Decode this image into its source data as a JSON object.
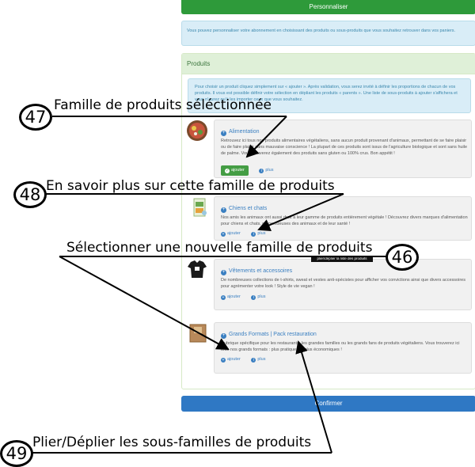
{
  "buttons": {
    "personnaliser": "Personnaliser",
    "confirmer": "Confirmer"
  },
  "info_top": "Vous pouvez personnaliser votre abonnement en choisissant des produits ou sous-produits que vous souhaitez retrouver dans vos paniers.",
  "panel": {
    "title": "Produits",
    "info": "Pour choisir un produit cliquez simplement sur « ajouter ». Après validation, vous serez invité à définir les proportions de chacun de vos produits. Il vous est possible définir votre sélection en dépliant les produits « parents ». Une liste de sous-produits à ajouter s'affichera et vous n'aurez qu'à les importer ceux que vous souhaitez."
  },
  "items": [
    {
      "title": "Alimentation",
      "desc": "Retrouvez ici tous nos produits alimentaires végétaliens, sans aucun produit provenant d'animaux, permettant de se faire plaisir ou de faire plaisir sans mauvaise conscience ! La plupart de ces produits sont issus de l'agriculture biologique et sont sans huile de palme. Vous trouverez également des produits sans gluten ou 100% crus. Bon appétit !",
      "add": "ajouter",
      "more": "plus",
      "selected": true
    },
    {
      "title": "Chiens et chats",
      "desc": "Nos amis les animaux ont aussi droit à leur gamme de produits entièrement végétale ! Découvrez divers marques d'alimentation pour chiens et chats, respectueuses des animaux et de leur santé !",
      "add": "ajouter",
      "more": "plus",
      "selected": false
    },
    {
      "title": "Vêtements et accessoires",
      "desc": "De nombreuses collections de t-shirts, sweat et vestes anti-spécistes pour afficher vos convictions ainsi que divers accessoires pour agrémenter votre look ! Style de vie vegan !",
      "add": "ajouter",
      "more": "plus",
      "selected": false
    },
    {
      "title": "Grands Formats | Pack restauration",
      "desc": "Rubrique spécifique pour les restaurants, les grandes familles ou les grands fans de produits végétaliens. Vous trouverez ici tous nos grands formats : plus pratiques et plus économiques !",
      "add": "ajouter",
      "more": "plus",
      "selected": false
    }
  ],
  "tooltip": "plier/déplier la liste des produits",
  "callouts": {
    "c47": {
      "num": "47",
      "text": "Famille de produits séléctionnée"
    },
    "c48": {
      "num": "48",
      "text": "En savoir plus sur cette famille de produits"
    },
    "c46": {
      "num": "46",
      "text": "Sélectionner une nouvelle famille de produits"
    },
    "c49": {
      "num": "49",
      "text": "Plier/Déplier les sous-familles de produits"
    }
  },
  "colors": {
    "green": "#2e9a3a",
    "blue": "#2f78c4",
    "link": "#3a7fc1"
  }
}
